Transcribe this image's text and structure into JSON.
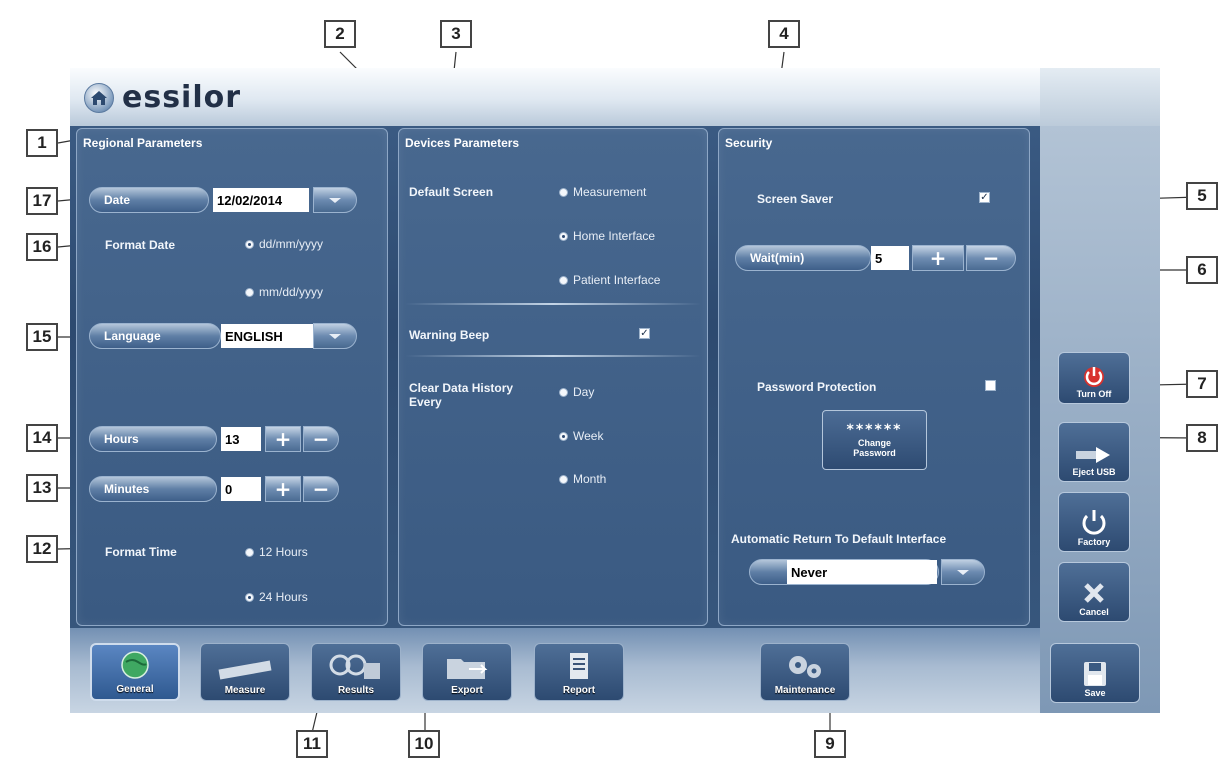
{
  "brand": {
    "name": "essilor"
  },
  "regional": {
    "title": "Regional Parameters",
    "date_label": "Date",
    "date_value": "12/02/2014",
    "format_date_label": "Format Date",
    "format_date_options": [
      "dd/mm/yyyy",
      "mm/dd/yyyy"
    ],
    "format_date_selected": "dd/mm/yyyy",
    "language_label": "Language",
    "language_value": "ENGLISH",
    "hours_label": "Hours",
    "hours_value": "13",
    "minutes_label": "Minutes",
    "minutes_value": "0",
    "format_time_label": "Format Time",
    "format_time_options": [
      "12 Hours",
      "24 Hours"
    ],
    "format_time_selected": "24 Hours"
  },
  "devices": {
    "title": "Devices Parameters",
    "default_screen_label": "Default Screen",
    "default_screen_options": [
      "Measurement",
      "Home Interface",
      "Patient Interface"
    ],
    "default_screen_selected": "Home Interface",
    "warning_beep_label": "Warning Beep",
    "warning_beep_checked": true,
    "clear_history_label_1": "Clear Data History",
    "clear_history_label_2": "Every",
    "clear_history_options": [
      "Day",
      "Week",
      "Month"
    ],
    "clear_history_selected": "Week"
  },
  "security": {
    "title": "Security",
    "screen_saver_label": "Screen Saver",
    "screen_saver_checked": true,
    "wait_label": "Wait(min)",
    "wait_value": "5",
    "password_protection_label": "Password Protection",
    "password_protection_checked": false,
    "change_password_mask": "******",
    "change_password_label_1": "Change",
    "change_password_label_2": "Password",
    "auto_return_label": "Automatic Return To Default Interface",
    "auto_return_value": "Never"
  },
  "stepper": {
    "plus": "+",
    "minus": "−"
  },
  "nav": {
    "general": "General",
    "measure": "Measure",
    "results": "Results",
    "export": "Export",
    "report": "Report",
    "maintenance": "Maintenance"
  },
  "side": {
    "turn_off": "Turn Off",
    "eject_usb": "Eject USB",
    "factory": "Factory",
    "cancel": "Cancel",
    "save": "Save"
  },
  "callouts": {
    "c1": "1",
    "c2": "2",
    "c3": "3",
    "c4": "4",
    "c5": "5",
    "c6": "6",
    "c7": "7",
    "c8": "8",
    "c9": "9",
    "c10": "10",
    "c11": "11",
    "c12": "12",
    "c13": "13",
    "c14": "14",
    "c15": "15",
    "c16": "16",
    "c17": "17"
  },
  "colors": {
    "panel": "#3a5a82",
    "header": "#dfe8f1",
    "accent": "#5a86c2"
  }
}
